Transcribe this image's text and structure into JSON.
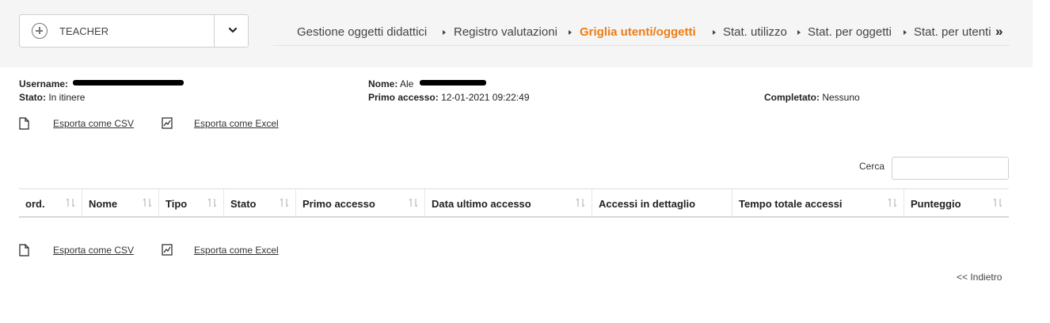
{
  "role_selector": {
    "label": "TEACHER"
  },
  "tabs": [
    {
      "label": "Gestione oggetti didattici",
      "active": false
    },
    {
      "label": "Registro valutazioni",
      "active": false
    },
    {
      "label": "Griglia utenti/oggetti",
      "active": true
    },
    {
      "label": "Stat. utilizzo",
      "active": false
    },
    {
      "label": "Stat. per oggetti",
      "active": false
    },
    {
      "label": "Stat. per utenti",
      "active": false
    }
  ],
  "tabs_more": "»",
  "user_info": {
    "username_label": "Username",
    "username_value": "",
    "stato_label": "Stato",
    "stato_value": "In itinere",
    "nome_label": "Nome",
    "nome_value": "Ale",
    "primo_accesso_label": "Primo accesso",
    "primo_accesso_value": "12-01-2021 09:22:49",
    "completato_label": "Completato",
    "completato_value": "Nessuno"
  },
  "export": {
    "csv_label": "Esporta come CSV",
    "excel_label": "Esporta come Excel"
  },
  "search": {
    "label": "Cerca",
    "placeholder": ""
  },
  "table": {
    "columns": [
      "ord.",
      "Nome",
      "Tipo",
      "Stato",
      "Primo accesso",
      "Data ultimo accesso",
      "Accessi in dettaglio",
      "Tempo totale accessi",
      "Punteggio"
    ],
    "sortable": [
      true,
      true,
      true,
      true,
      true,
      true,
      false,
      true,
      true
    ],
    "rows": []
  },
  "back_link": "<< Indietro",
  "colors": {
    "accent": "#ee7d11",
    "topbar_bg": "#f5f5f5",
    "border": "#cfcfcf"
  },
  "icons": {
    "add": "plus-circle-icon",
    "dropdown": "chevron-down-icon",
    "csv": "file-icon",
    "excel": "chart-file-icon",
    "sort": "sort-icon",
    "more": "double-chevron-right-icon"
  }
}
